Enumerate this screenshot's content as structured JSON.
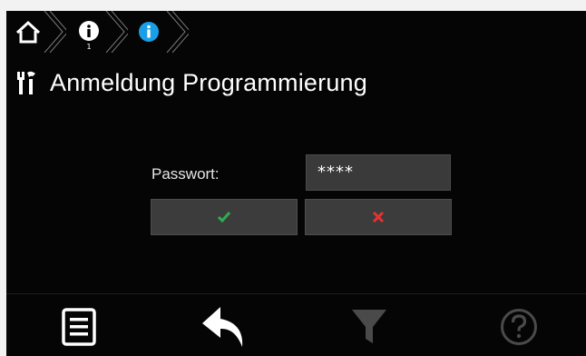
{
  "header": {
    "breadcrumb": [
      {
        "icon": "home-icon"
      },
      {
        "icon": "info-icon",
        "sub": "1"
      },
      {
        "icon": "info-active-icon"
      }
    ],
    "title": "Anmeldung Programmierung",
    "title_icon": "tools-icon"
  },
  "login": {
    "password_label": "Passwort:",
    "password_value": "****",
    "confirm_icon": "checkmark-icon",
    "cancel_icon": "cross-icon"
  },
  "bottom_nav": [
    {
      "icon": "list-icon",
      "enabled": true
    },
    {
      "icon": "back-arrow-icon",
      "enabled": true
    },
    {
      "icon": "filter-icon",
      "enabled": false
    },
    {
      "icon": "help-icon",
      "enabled": false
    }
  ],
  "colors": {
    "background": "#050505",
    "accent": "#1a9fe6",
    "confirm": "#2fae4f",
    "cancel": "#e63232"
  }
}
